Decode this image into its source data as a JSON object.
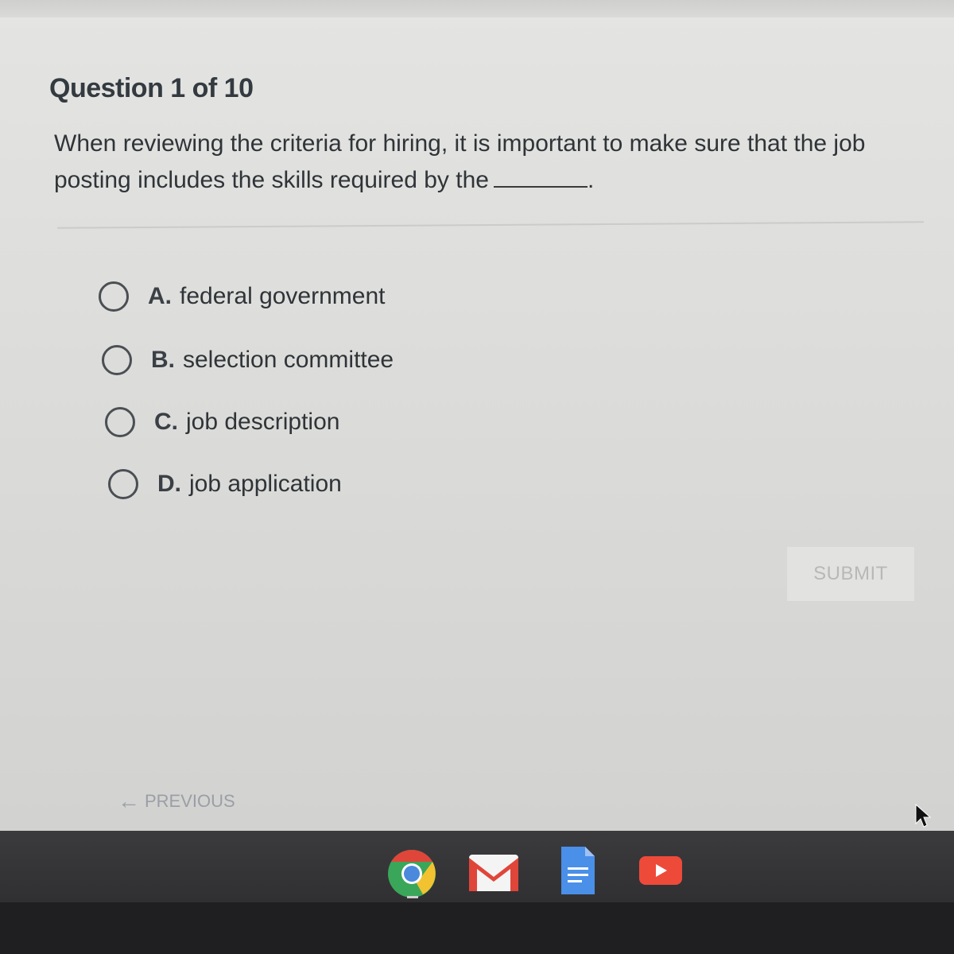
{
  "question": {
    "number": "Question 1 of 10",
    "text": "When reviewing the criteria for hiring, it is important to make sure that the job posting includes the skills required by the",
    "end": "."
  },
  "options": [
    {
      "letter": "A.",
      "text": "federal government"
    },
    {
      "letter": "B.",
      "text": "selection committee"
    },
    {
      "letter": "C.",
      "text": "job description"
    },
    {
      "letter": "D.",
      "text": "job application"
    }
  ],
  "submit_label": "SUBMIT",
  "previous_label": "PREVIOUS",
  "shelf_apps": [
    "chrome-icon",
    "gmail-icon",
    "docs-icon",
    "youtube-icon"
  ],
  "colors": {
    "chrome_red": "#e0453a",
    "chrome_yellow": "#f2c230",
    "chrome_green": "#3aa65a",
    "chrome_blue": "#4a89dc",
    "gmail_red": "#e0453a",
    "docs_blue": "#4a8fe8",
    "youtube_red": "#ee4a3a"
  }
}
